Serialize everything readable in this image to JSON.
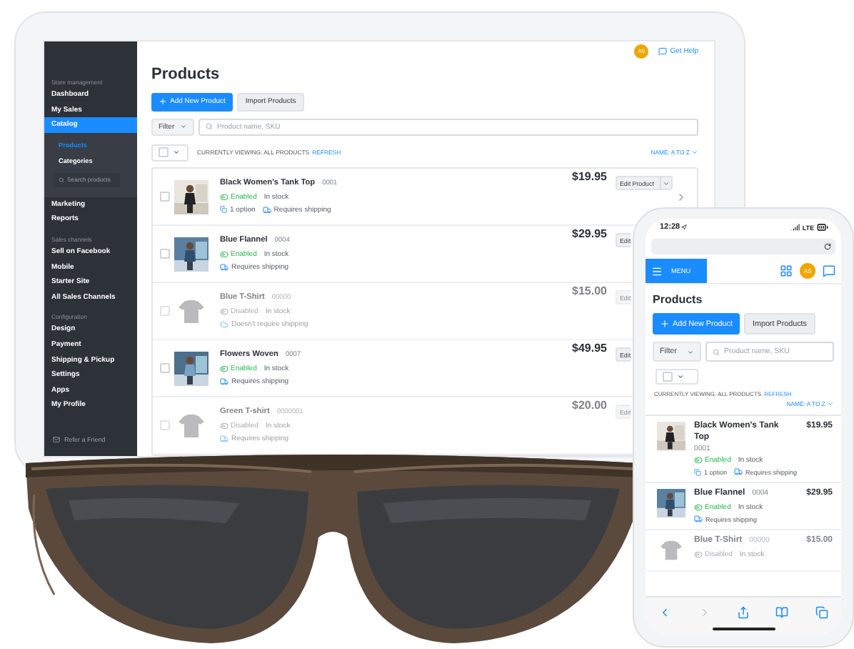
{
  "tablet": {
    "sidebar": {
      "sections": [
        {
          "heading": "Store management",
          "items": [
            {
              "label": "Dashboard",
              "selected": false
            },
            {
              "label": "My Sales",
              "selected": false
            },
            {
              "label": "Catalog",
              "selected": true,
              "expanded": true,
              "search_placeholder": "Search products",
              "children": [
                {
                  "label": "Products",
                  "selected": true
                },
                {
                  "label": "Categories",
                  "selected": false
                }
              ]
            },
            {
              "label": "Marketing",
              "selected": false
            },
            {
              "label": "Reports",
              "selected": false
            }
          ]
        },
        {
          "heading": "Sales channels",
          "items": [
            {
              "label": "Sell on Facebook",
              "selected": false
            },
            {
              "label": "Mobile",
              "selected": false
            },
            {
              "label": "Starter Site",
              "selected": false
            },
            {
              "label": "All Sales Channels",
              "selected": false
            }
          ]
        },
        {
          "heading": "Configuration",
          "items": [
            {
              "label": "Design",
              "selected": false
            },
            {
              "label": "Payment",
              "selected": false
            },
            {
              "label": "Shipping & Pickup",
              "selected": false
            },
            {
              "label": "Settings",
              "selected": false
            },
            {
              "label": "Apps",
              "selected": false
            },
            {
              "label": "My Profile",
              "selected": false
            }
          ]
        }
      ],
      "footer_link": "Refer a Friend"
    },
    "header": {
      "avatar": "AS",
      "help": "Get Help"
    },
    "title": "Products",
    "buttons": [
      {
        "label": "Add New Product",
        "kind": "primary"
      },
      {
        "label": "Import Products",
        "kind": "secondary"
      }
    ],
    "filter": "Filter",
    "search": {
      "placeholder": "Product name, SKU"
    },
    "select_all_checked": false,
    "viewing": "CURRENTLY VIEWING: ALL PRODUCTS",
    "refresh": "REFRESH",
    "sort": "NAME: A TO Z",
    "products": [
      {
        "name": "Black Women's Tank Top",
        "code": "0001",
        "enabled": true,
        "status": "Enabled",
        "stock": "In stock",
        "options": "1 option",
        "ships": true,
        "shipping": "Requires shipping",
        "price": "$19.95",
        "edit": "Edit Product",
        "edit_menu": true,
        "expand_arrow": true,
        "checked": false
      },
      {
        "name": "Blue Flannel",
        "code": "0004",
        "enabled": true,
        "status": "Enabled",
        "stock": "In stock",
        "ships": true,
        "shipping": "Requires shipping",
        "price": "$29.95",
        "edit": "Edit",
        "edit_menu": false,
        "expand_arrow": false,
        "checked": false
      },
      {
        "name": "Blue T-Shirt",
        "code": "00000",
        "enabled": false,
        "status": "Disabled",
        "stock": "In stock",
        "ships": false,
        "shipping": "Doesn't require shipping",
        "price": "$15.00",
        "edit": "Edit",
        "edit_menu": false,
        "expand_arrow": false,
        "checked": false
      },
      {
        "name": "Flowers Woven",
        "code": "0007",
        "enabled": true,
        "status": "Enabled",
        "stock": "In stock",
        "ships": true,
        "shipping": "Requires shipping",
        "price": "$49.95",
        "edit": "Edit",
        "edit_menu": false,
        "expand_arrow": false,
        "checked": false
      },
      {
        "name": "Green T-shirt",
        "code": "0000001",
        "enabled": false,
        "status": "Disabled",
        "stock": "In stock",
        "ships": true,
        "shipping": "Requires shipping",
        "price": "$20.00",
        "edit": "Edit",
        "edit_menu": false,
        "expand_arrow": false,
        "checked": false
      }
    ]
  },
  "phone": {
    "time": "12:28",
    "network": "LTE",
    "menu": "MENU",
    "avatar": "AS",
    "title": "Products",
    "buttons": [
      {
        "label": "Add New Product",
        "kind": "primary"
      },
      {
        "label": "Import Products",
        "kind": "secondary"
      }
    ],
    "filter": "Filter",
    "search": {
      "placeholder": "Product name, SKU"
    },
    "select_all_checked": false,
    "viewing": "CURRENTLY VIEWING: ALL PRODUCTS",
    "refresh": "REFRESH",
    "sort": "NAME: A TO Z",
    "products": [
      {
        "name": "Black Women's Tank Top",
        "code": "0001",
        "enabled": true,
        "status": "Enabled",
        "stock": "In stock",
        "options": "1 option",
        "ships": true,
        "shipping": "Requires shipping",
        "price": "$19.95"
      },
      {
        "name": "Blue Flannel",
        "code": "0004",
        "enabled": true,
        "status": "Enabled",
        "stock": "In stock",
        "ships": true,
        "shipping": "Requires shipping",
        "price": "$29.95"
      },
      {
        "name": "Blue T-Shirt",
        "code": "00000",
        "enabled": false,
        "status": "Disabled",
        "stock": "In stock",
        "price": "$15.00"
      }
    ],
    "toolbar": {
      "back_disabled": false,
      "forward_disabled": true
    }
  }
}
